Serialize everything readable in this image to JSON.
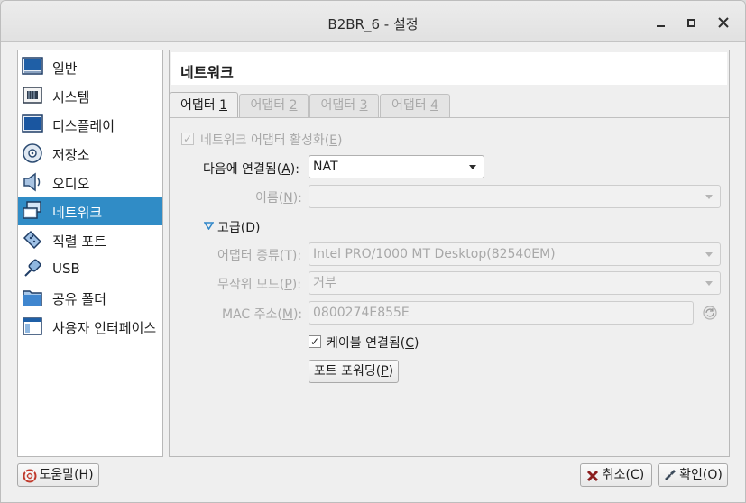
{
  "window": {
    "title": "B2BR_6 - 설정"
  },
  "sidebar": {
    "items": [
      {
        "label": "일반",
        "icon": "general-icon"
      },
      {
        "label": "시스템",
        "icon": "system-chip-icon"
      },
      {
        "label": "디스플레이",
        "icon": "monitor-icon"
      },
      {
        "label": "저장소",
        "icon": "storage-disk-icon"
      },
      {
        "label": "오디오",
        "icon": "speaker-icon"
      },
      {
        "label": "네트워크",
        "icon": "network-icon",
        "selected": true
      },
      {
        "label": "직렬 포트",
        "icon": "serial-port-icon"
      },
      {
        "label": "USB",
        "icon": "usb-icon"
      },
      {
        "label": "공유 폴더",
        "icon": "folder-icon"
      },
      {
        "label": "사용자 인터페이스",
        "icon": "user-interface-icon"
      }
    ]
  },
  "page": {
    "title": "네트워크"
  },
  "tabs": [
    {
      "label": "어댑터 ",
      "num": "1",
      "active": true
    },
    {
      "label": "어댑터 ",
      "num": "2"
    },
    {
      "label": "어댑터 ",
      "num": "3"
    },
    {
      "label": "어댑터 ",
      "num": "4"
    }
  ],
  "adapter": {
    "enable_label": "네트워크 어댑터 활성화(",
    "enable_key": "E",
    "enable_end": ")",
    "enable_checked": true,
    "attached_label": "다음에 연결됨(",
    "attached_key": "A",
    "attached_end": "):",
    "attached_value": "NAT",
    "name_label": "이름(",
    "name_key": "N",
    "name_end": "):",
    "name_value": "",
    "advanced_label": "고급(",
    "advanced_key": "D",
    "advanced_end": ")",
    "type_label": "어댑터 종류(",
    "type_key": "T",
    "type_end": "):",
    "type_value": "Intel PRO/1000 MT Desktop(82540EM)",
    "promisc_label": "무작위 모드(",
    "promisc_key": "P",
    "promisc_end": "):",
    "promisc_value": "거부",
    "mac_label": "MAC 주소(",
    "mac_key": "M",
    "mac_end": "):",
    "mac_value": "0800274E855E",
    "cable_label": "케이블 연결됨(",
    "cable_key": "C",
    "cable_end": ")",
    "cable_checked": true,
    "port_forward_label": "포트 포워딩(",
    "port_forward_key": "P",
    "port_forward_end": ")"
  },
  "footer": {
    "help_label": "도움말(",
    "help_key": "H",
    "help_end": ")",
    "cancel_label": "취소(",
    "cancel_key": "C",
    "cancel_end": ")",
    "ok_label": "확인(",
    "ok_key": "O",
    "ok_end": ")"
  },
  "colors": {
    "selection": "#308cc6",
    "window_bg": "#efefef"
  }
}
